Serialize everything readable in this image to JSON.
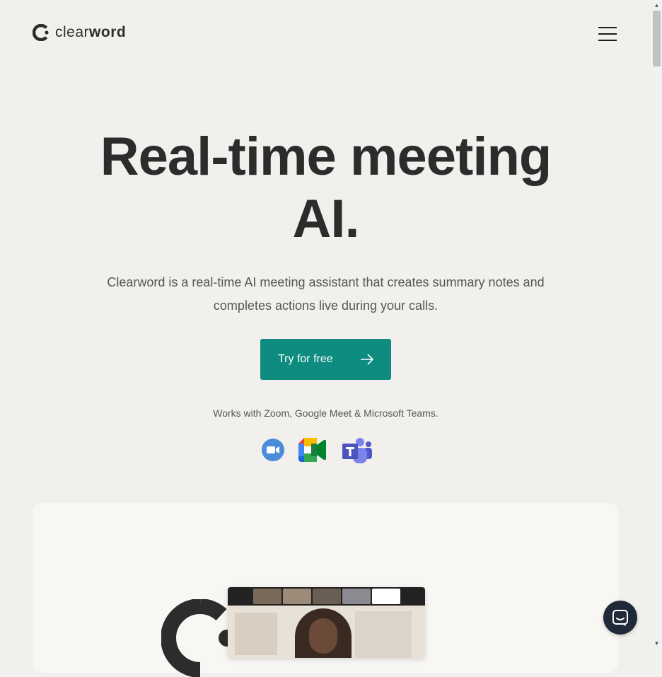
{
  "brand": {
    "name_regular": "clear",
    "name_bold": "word",
    "accent": "#0e8c80"
  },
  "nav": {
    "menu_icon": "hamburger-icon"
  },
  "hero": {
    "title_line1": "Real-time meeting",
    "title_line2": "AI.",
    "subtitle": "Clearword is a real-time AI meeting assistant that creates summary notes and completes actions live during your calls.",
    "cta_label": "Try for free",
    "cta_icon": "arrow-right-icon",
    "works_with": "Works with Zoom, Google Meet & Microsoft Teams."
  },
  "integrations": [
    {
      "name": "Zoom",
      "icon": "zoom-icon"
    },
    {
      "name": "Google Meet",
      "icon": "google-meet-icon"
    },
    {
      "name": "Microsoft Teams",
      "icon": "microsoft-teams-icon"
    }
  ],
  "chat": {
    "icon": "chat-icon"
  }
}
